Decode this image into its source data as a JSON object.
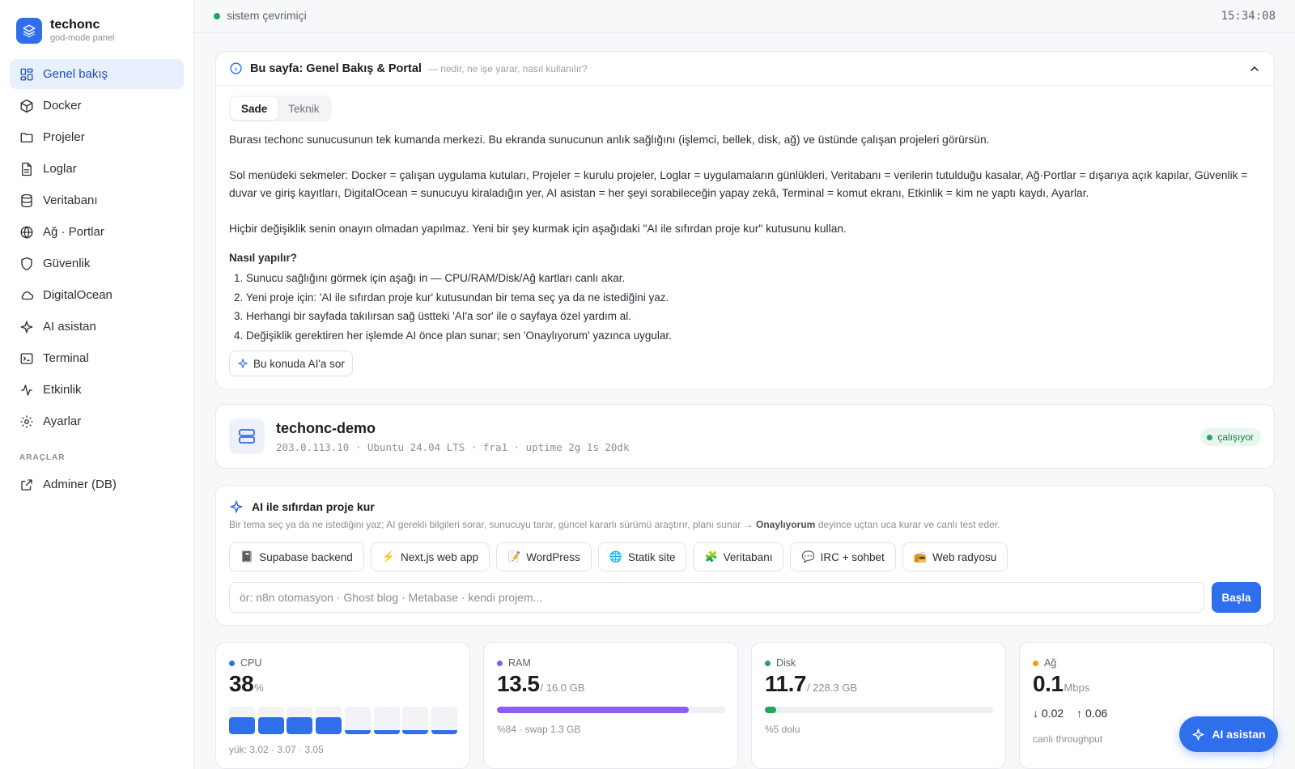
{
  "brand": {
    "name": "techonc",
    "subtitle": "god-mode panel"
  },
  "sidebar": {
    "items": [
      {
        "label": "Genel bakış",
        "icon": "grid-icon",
        "active": true
      },
      {
        "label": "Docker",
        "icon": "box-icon"
      },
      {
        "label": "Projeler",
        "icon": "folder-icon"
      },
      {
        "label": "Loglar",
        "icon": "file-text-icon"
      },
      {
        "label": "Veritabanı",
        "icon": "database-icon"
      },
      {
        "label": "Ağ · Portlar",
        "icon": "globe-icon"
      },
      {
        "label": "Güvenlik",
        "icon": "shield-icon"
      },
      {
        "label": "DigitalOcean",
        "icon": "cloud-icon"
      },
      {
        "label": "AI asistan",
        "icon": "sparkle-icon"
      },
      {
        "label": "Terminal",
        "icon": "terminal-icon"
      },
      {
        "label": "Etkinlik",
        "icon": "activity-icon"
      },
      {
        "label": "Ayarlar",
        "icon": "gear-icon"
      }
    ],
    "tools_section": "ARAÇLAR",
    "tools": [
      {
        "label": "Adminer (DB)",
        "icon": "external-link-icon"
      }
    ]
  },
  "topbar": {
    "status": "sistem çevrimiçi",
    "clock": "15:34:08"
  },
  "info": {
    "title": "Bu sayfa: Genel Bakış & Portal",
    "hint": "— nedir, ne işe yarar, nasıl kullanılır?",
    "tabs": [
      "Sade",
      "Teknik"
    ],
    "paragraphs": [
      "Burası techonc sunucusunun tek kumanda merkezi. Bu ekranda sunucunun anlık sağlığını (işlemci, bellek, disk, ağ) ve üstünde çalışan projeleri görürsün.",
      "Sol menüdeki sekmeler: Docker = çalışan uygulama kutuları, Projeler = kurulu projeler, Loglar = uygulamaların günlükleri, Veritabanı = verilerin tutulduğu kasalar, Ağ·Portlar = dışarıya açık kapılar, Güvenlik = duvar ve giriş kayıtları, DigitalOcean = sunucuyu kiraladığın yer, AI asistan = her şeyi sorabileceğin yapay zekâ, Terminal = komut ekranı, Etkinlik = kim ne yaptı kaydı, Ayarlar.",
      "Hiçbir değişiklik senin onayın olmadan yapılmaz. Yeni bir şey kurmak için aşağıdaki \"AI ile sıfırdan proje kur\" kutusunu kullan."
    ],
    "howto_title": "Nasıl yapılır?",
    "steps": [
      "1. Sunucu sağlığını görmek için aşağı in — CPU/RAM/Disk/Ağ kartları canlı akar.",
      "2. Yeni proje için: 'AI ile sıfırdan proje kur' kutusundan bir tema seç ya da ne istediğini yaz.",
      "3. Herhangi bir sayfada takılırsan sağ üstteki 'AI'a sor' ile o sayfaya özel yardım al.",
      "4. Değişiklik gerektiren her işlemde AI önce plan sunar; sen 'Onaylıyorum' yazınca uygular."
    ],
    "ask_button": "Bu konuda AI'a sor"
  },
  "server": {
    "name": "techonc-demo",
    "meta": "203.0.113.10 · Ubuntu 24.04 LTS · fra1 · uptime 2g 1s 20dk",
    "status": "çalışıyor"
  },
  "ai_builder": {
    "title": "AI ile sıfırdan proje kur",
    "desc_before": "Bir tema seç ya da ne istediğini yaz; AI gerekli bilgileri sorar, sunucuyu tarar, güncel kararlı sürümü araştırır, planı sunar →",
    "desc_bold": "Onaylıyorum",
    "desc_after": "deyince uçtan uca kurar ve canlı test eder.",
    "chips": [
      {
        "emoji": "📓",
        "label": "Supabase backend"
      },
      {
        "emoji": "⚡",
        "label": "Next.js web app"
      },
      {
        "emoji": "📝",
        "label": "WordPress"
      },
      {
        "emoji": "🌐",
        "label": "Statik site"
      },
      {
        "emoji": "🧩",
        "label": "Veritabanı"
      },
      {
        "emoji": "💬",
        "label": "IRC + sohbet"
      },
      {
        "emoji": "📻",
        "label": "Web radyosu"
      }
    ],
    "placeholder": "ör: n8n otomasyon · Ghost blog · Metabase · kendi projem...",
    "start": "Başla"
  },
  "metrics": {
    "cpu": {
      "label": "CPU",
      "value": "38",
      "unit": "%",
      "load": "yük: 3.02 · 3.07 · 3.05",
      "color": "#2f6fec",
      "core_levels": [
        0.62,
        0.62,
        0.62,
        0.62,
        0.14,
        0.14,
        0.14,
        0.14
      ]
    },
    "ram": {
      "label": "RAM",
      "value": "13.5",
      "unit": "/ 16.0 GB",
      "sub": "%84 · swap 1.3 GB",
      "color": "#8b5cf6",
      "fraction": 0.84
    },
    "disk": {
      "label": "Disk",
      "value": "11.7",
      "unit": "/ 228.3 GB",
      "sub": "%5 dolu",
      "color": "#22a55a",
      "fraction": 0.05
    },
    "net": {
      "label": "Ağ",
      "value": "0.1",
      "unit": "Mbps",
      "down": "↓ 0.02",
      "up": "↑ 0.06",
      "sub": "canlı throughput",
      "color": "#f59e0b"
    }
  },
  "fab": {
    "label": "AI asistan"
  }
}
